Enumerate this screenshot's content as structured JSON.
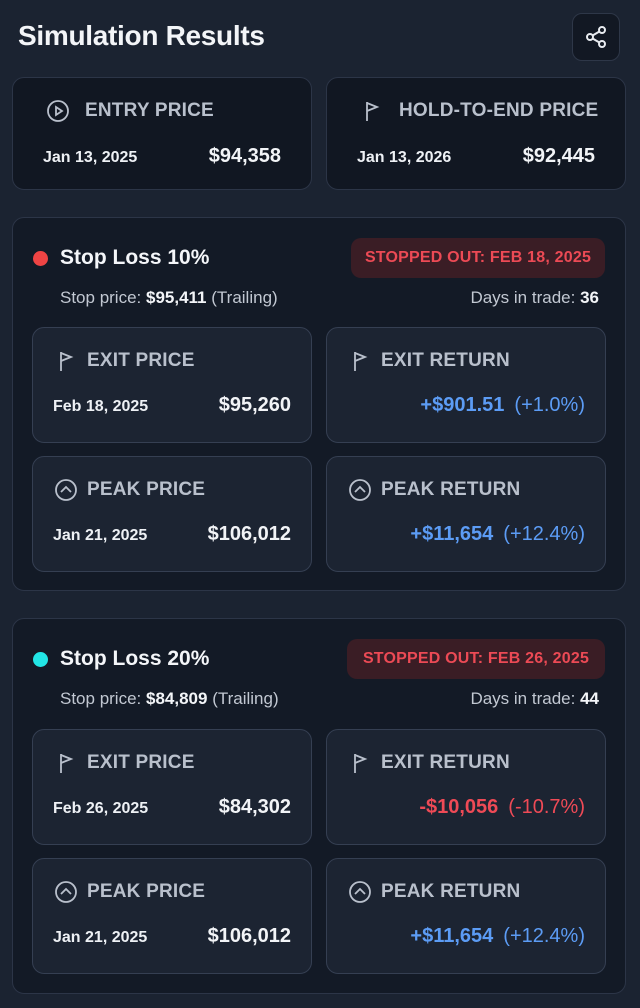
{
  "header": {
    "title": "Simulation Results",
    "share_icon": "share-icon"
  },
  "summary": {
    "entry": {
      "label": "ENTRY PRICE",
      "date": "Jan 13, 2025",
      "value": "$94,358"
    },
    "hold": {
      "label": "HOLD-TO-END PRICE",
      "date": "Jan 13, 2026",
      "value": "$92,445"
    }
  },
  "strategies": [
    {
      "title": "Stop Loss 10%",
      "dot_color": "#ef4444",
      "badge": "STOPPED OUT: FEB 18, 2025",
      "stop_label": "Stop price:",
      "stop_value": "$95,411",
      "stop_type": "(Trailing)",
      "days_label": "Days in trade:",
      "days_value": "36",
      "exit_price": {
        "label": "EXIT PRICE",
        "date": "Feb 18, 2025",
        "value": "$95,260"
      },
      "exit_return": {
        "label": "EXIT RETURN",
        "amount": "+$901.51",
        "pct": "(+1.0%)",
        "sign": "positive"
      },
      "peak_price": {
        "label": "PEAK PRICE",
        "date": "Jan 21, 2025",
        "value": "$106,012"
      },
      "peak_return": {
        "label": "PEAK RETURN",
        "amount": "+$11,654",
        "pct": "(+12.4%)",
        "sign": "positive"
      }
    },
    {
      "title": "Stop Loss 20%",
      "dot_color": "#22e5e5",
      "badge": "STOPPED OUT: FEB 26, 2025",
      "stop_label": "Stop price:",
      "stop_value": "$84,809",
      "stop_type": "(Trailing)",
      "days_label": "Days in trade:",
      "days_value": "44",
      "exit_price": {
        "label": "EXIT PRICE",
        "date": "Feb 26, 2025",
        "value": "$84,302"
      },
      "exit_return": {
        "label": "EXIT RETURN",
        "amount": "-$10,056",
        "pct": "(-10.7%)",
        "sign": "negative"
      },
      "peak_price": {
        "label": "PEAK PRICE",
        "date": "Jan 21, 2025",
        "value": "$106,012"
      },
      "peak_return": {
        "label": "PEAK RETURN",
        "amount": "+$11,654",
        "pct": "(+12.4%)",
        "sign": "positive"
      }
    }
  ],
  "colors": {
    "positive": "#5c9cf5",
    "negative": "#ef4a56",
    "badge_text": "#ec4a55"
  }
}
